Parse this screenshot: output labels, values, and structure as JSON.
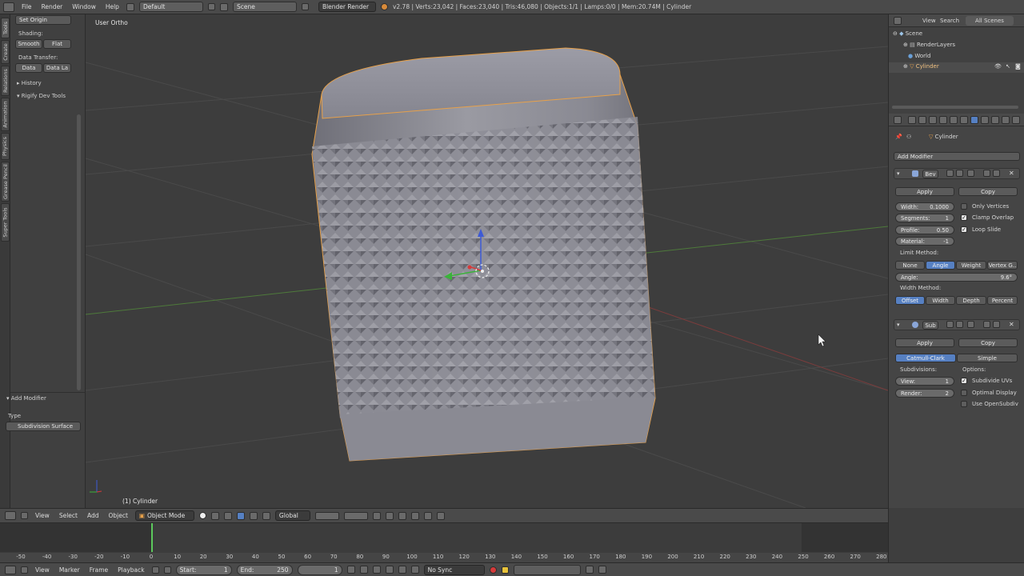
{
  "topbar": {
    "menus": [
      "File",
      "Render",
      "Window",
      "Help"
    ],
    "layout": "Default",
    "scene": "Scene",
    "engine": "Blender Render",
    "stats": "v2.78 | Verts:23,042 | Faces:23,040 | Tris:46,080 | Objects:1/1 | Lamps:0/0 | Mem:20.74M | Cylinder"
  },
  "left_tabs": [
    "Tools",
    "Create",
    "Relations",
    "Animation",
    "Physics",
    "Grease Pencil",
    "Super Tools"
  ],
  "toolshelf": {
    "set_origin": "Set Origin",
    "shading_label": "Shading:",
    "smooth": "Smooth",
    "flat": "Flat",
    "data_transfer_label": "Data Transfer:",
    "data": "Data",
    "data_la": "Data La",
    "history": "History",
    "rigify": "Rigify Dev Tools",
    "operator_panel": "Add Modifier",
    "type_label": "Type",
    "type_value": "Subdivision Surface"
  },
  "viewport": {
    "view_name": "User Ortho",
    "object_label": "(1) Cylinder"
  },
  "outliner": {
    "tabs": [
      "View",
      "Search",
      "All Scenes"
    ],
    "items": [
      "Scene",
      "RenderLayers",
      "World",
      "Cylinder"
    ]
  },
  "properties": {
    "object_name": "Cylinder",
    "add_modifier": "Add Modifier",
    "bevel": {
      "name": "Bev",
      "apply": "Apply",
      "copy": "Copy",
      "width_label": "Width:",
      "width_value": "0.1000",
      "segments_label": "Segments:",
      "segments_value": "1",
      "profile_label": "Profile:",
      "profile_value": "0.50",
      "material_label": "Material:",
      "material_value": "-1",
      "only_vertices": "Only Vertices",
      "clamp_overlap": "Clamp Overlap",
      "loop_slide": "Loop Slide",
      "limit_method_label": "Limit Method:",
      "limit_methods": [
        "None",
        "Angle",
        "Weight",
        "Vertex G.."
      ],
      "limit_active": 1,
      "angle_label": "Angle:",
      "angle_value": "9.6°",
      "width_method_label": "Width Method:",
      "width_methods": [
        "Offset",
        "Width",
        "Depth",
        "Percent"
      ],
      "width_active": 0
    },
    "subsurf": {
      "name": "Sub",
      "apply": "Apply",
      "copy": "Copy",
      "catmull": "Catmull-Clark",
      "simple": "Simple",
      "subdivisions_label": "Subdivisions:",
      "options_label": "Options:",
      "view_label": "View:",
      "view_value": "1",
      "render_label": "Render:",
      "render_value": "2",
      "subdivide_uvs": "Subdivide UVs",
      "optimal_display": "Optimal Display",
      "use_opensubdiv": "Use OpenSubdiv"
    }
  },
  "view_header": {
    "menus": [
      "View",
      "Select",
      "Add",
      "Object"
    ],
    "mode": "Object Mode",
    "orientation": "Global"
  },
  "timeline": {
    "ticks": [
      "-50",
      "-40",
      "-30",
      "-20",
      "-10",
      "0",
      "10",
      "20",
      "30",
      "40",
      "50",
      "60",
      "70",
      "80",
      "90",
      "100",
      "110",
      "120",
      "130",
      "140",
      "150",
      "160",
      "170",
      "180",
      "190",
      "200",
      "210",
      "220",
      "230",
      "240",
      "250",
      "260",
      "270",
      "280"
    ],
    "menus": [
      "View",
      "Marker",
      "Frame",
      "Playback"
    ],
    "start_label": "Start:",
    "start_value": "1",
    "end_label": "End:",
    "end_value": "250",
    "current": "1",
    "sync": "No Sync"
  },
  "colors": {
    "accent": "#5680c2",
    "selection_outline": "#e8a14a"
  }
}
